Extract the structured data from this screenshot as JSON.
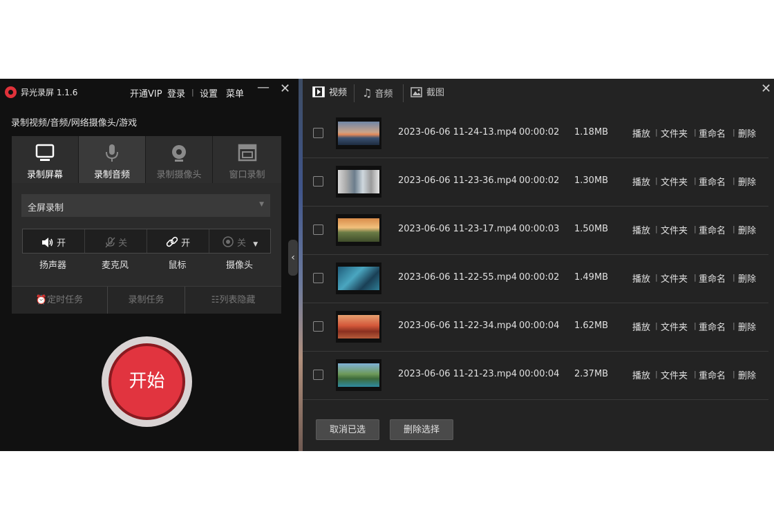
{
  "app": {
    "title": "异光录屏 1.1.6",
    "top_menu": [
      "开通VIP",
      "登录",
      "设置",
      "菜单"
    ],
    "minimize_icon": "minimize-icon",
    "close_icon": "close-icon"
  },
  "left": {
    "subtitle": "录制视频/音频/网络摄像头/游戏",
    "modes": [
      {
        "label": "录制屏幕",
        "icon": "monitor-icon"
      },
      {
        "label": "录制音频",
        "icon": "microphone-icon"
      },
      {
        "label": "录制摄像头",
        "icon": "webcam-icon"
      },
      {
        "label": "窗口录制",
        "icon": "window-icon"
      }
    ],
    "active_mode": "录制音频",
    "select_value": "全屏录制",
    "devices": [
      {
        "label": "扬声器",
        "state": "开",
        "icon": "speaker-icon"
      },
      {
        "label": "麦克风",
        "state": "关",
        "icon": "microphone-off-icon"
      },
      {
        "label": "鼠标",
        "state": "开",
        "icon": "mouse-link-icon"
      },
      {
        "label": "摄像头",
        "state": "关",
        "icon": "camera-icon"
      }
    ],
    "bottom_buttons": [
      "定时任务",
      "录制任务",
      "列表隐藏"
    ],
    "start_label": "开始"
  },
  "right": {
    "tabs": [
      {
        "label": "视频",
        "icon": "video-icon"
      },
      {
        "label": "音频",
        "icon": "music-icon"
      },
      {
        "label": "截图",
        "icon": "image-icon"
      }
    ],
    "files": [
      {
        "name": "2023-06-06 11-24-13.mp4",
        "duration": "00:00:02",
        "size": "1.18MB"
      },
      {
        "name": "2023-06-06 11-23-36.mp4",
        "duration": "00:00:02",
        "size": "1.30MB"
      },
      {
        "name": "2023-06-06 11-23-17.mp4",
        "duration": "00:00:03",
        "size": "1.50MB"
      },
      {
        "name": "2023-06-06 11-22-55.mp4",
        "duration": "00:00:02",
        "size": "1.49MB"
      },
      {
        "name": "2023-06-06 11-22-34.mp4",
        "duration": "00:00:04",
        "size": "1.62MB"
      },
      {
        "name": "2023-06-06 11-21-23.mp4",
        "duration": "00:00:04",
        "size": "2.37MB"
      }
    ],
    "row_actions": [
      "播放",
      "文件夹",
      "重命名",
      "删除"
    ],
    "cancel_selected": "取消已选",
    "delete_selected": "删除选择"
  },
  "colors": {
    "accent": "#e1343f",
    "panel": "#2b2b2b",
    "background": "#111111"
  }
}
